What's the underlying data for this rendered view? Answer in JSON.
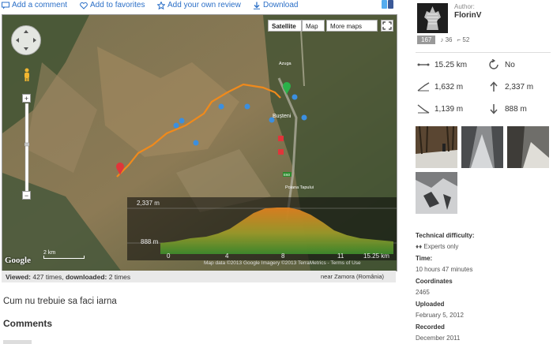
{
  "actions": {
    "add_comment": "Add a comment",
    "add_favorites": "Add to favorites",
    "add_review": "Add your own review",
    "download": "Download"
  },
  "map": {
    "type_buttons": [
      "Satellite",
      "Map",
      "More maps"
    ],
    "place_labels": {
      "azuga": "Azuga",
      "busteni": "Bușteni",
      "poiana_tapului": "Poiana Tapului"
    },
    "road_labels": [
      "DN1",
      "E60"
    ],
    "zoom_in": "+",
    "zoom_out": "−",
    "scale_label": "2 km",
    "google_logo": "Google",
    "copyright": "Map data ©2013 Google Imagery ©2013 TerraMetrics - Terms of Use",
    "route_color": "#f08a1c"
  },
  "elevation": {
    "max_label": "2,337 m",
    "min_label": "888 m",
    "x_ticks": [
      "0",
      "4",
      "8",
      "11",
      "15.25 km"
    ]
  },
  "stats_bar": {
    "viewed_label": "Viewed:",
    "viewed_value": "427 times",
    "downloaded_label": "downloaded:",
    "downloaded_value": "2 times",
    "near": "near Zamora (România)"
  },
  "trail_title": "Cum nu trebuie sa faci iarna",
  "comments_heading": "Comments",
  "author": {
    "label": "Author:",
    "name": "FlorinV",
    "count_badge": "167",
    "stat_a": "36",
    "stat_b": "52"
  },
  "trail_stats": {
    "distance": "15.25 km",
    "loop": "No",
    "elev_gain": "1,632 m",
    "max_alt": "2,337 m",
    "elev_loss": "1,139 m",
    "min_alt": "888 m"
  },
  "details": [
    {
      "label": "Technical difficulty:",
      "value": "♦♦ Experts only"
    },
    {
      "label": "Time:",
      "value": "10 hours 47 minutes"
    },
    {
      "label": "Coordinates",
      "value": "2465"
    },
    {
      "label": "Uploaded",
      "value": "February 5, 2012"
    },
    {
      "label": "Recorded",
      "value": "December 2011"
    }
  ]
}
